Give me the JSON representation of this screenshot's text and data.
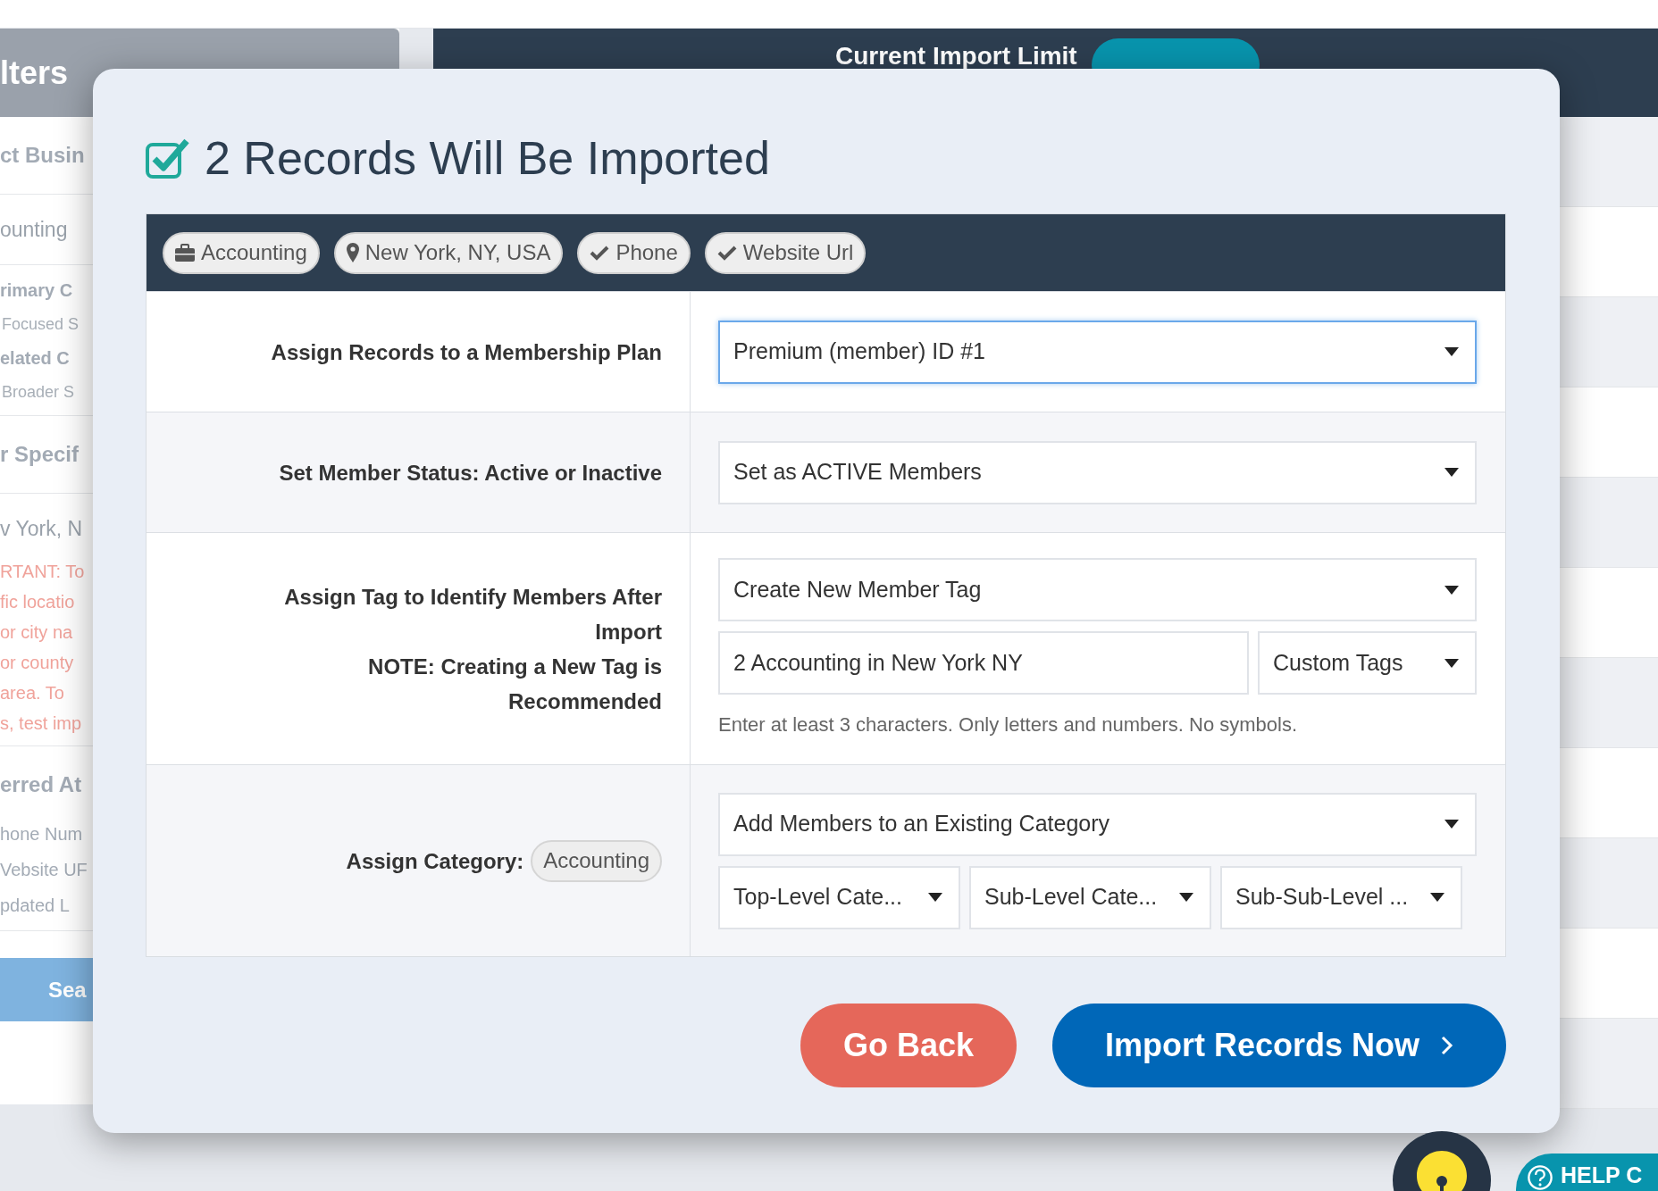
{
  "background": {
    "filters_title": "lters",
    "sections": [
      {
        "items": [
          {
            "kind": "heading",
            "text": "ct Busin"
          }
        ]
      },
      {
        "items": [
          {
            "kind": "value",
            "text": "ounting"
          }
        ]
      },
      {
        "items": [
          {
            "kind": "label",
            "text": "rimary C"
          },
          {
            "kind": "note",
            "text": "Focused S"
          },
          {
            "kind": "label",
            "text": "elated C"
          },
          {
            "kind": "note",
            "text": "Broader S"
          }
        ]
      },
      {
        "items": [
          {
            "kind": "heading",
            "text": "r Specif"
          }
        ]
      },
      {
        "items": [
          {
            "kind": "value",
            "text": "v York, N"
          },
          {
            "kind": "warning",
            "text": "RTANT: To"
          },
          {
            "kind": "warning",
            "text": "fic locatio"
          },
          {
            "kind": "warning",
            "text": "or city na"
          },
          {
            "kind": "warning",
            "text": "or county"
          },
          {
            "kind": "warning",
            "text": "area. To"
          },
          {
            "kind": "warning",
            "text": "s, test imp"
          }
        ]
      },
      {
        "items": [
          {
            "kind": "heading",
            "text": "erred At"
          },
          {
            "kind": "attr",
            "text": "hone Num"
          },
          {
            "kind": "attr",
            "text": "Vebsite UF"
          },
          {
            "kind": "attr",
            "text": "pdated L"
          }
        ]
      }
    ],
    "search_button": "Sea",
    "import_limit": "Current Import Limit"
  },
  "modal": {
    "title": "2 Records Will Be Imported",
    "title_checked": true,
    "chips": [
      {
        "kind": "industry",
        "label": "Accounting"
      },
      {
        "kind": "location",
        "label": "New York, NY, USA"
      },
      {
        "kind": "check",
        "label": "Phone"
      },
      {
        "kind": "check",
        "label": "Website Url"
      }
    ],
    "rows": [
      {
        "labels": [
          "Assign Records to a Membership Plan"
        ],
        "lines": [
          [
            {
              "kind": "select",
              "value": "Premium (member) ID #1",
              "focused": true
            }
          ]
        ]
      },
      {
        "labels": [
          "Set Member Status: Active or Inactive"
        ],
        "lines": [
          [
            {
              "kind": "select",
              "value": "Set as ACTIVE Members",
              "focused": false
            }
          ]
        ]
      },
      {
        "labels": [
          "Assign Tag to Identify Members After Import",
          "NOTE: Creating a New Tag is Recommended"
        ],
        "lines": [
          [
            {
              "kind": "select",
              "value": "Create New Member Tag",
              "focused": false
            }
          ],
          [
            {
              "kind": "input",
              "value": "2 Accounting in New York NY"
            },
            {
              "kind": "select",
              "value": "Custom Tags",
              "focused": false
            }
          ],
          [
            {
              "kind": "hint",
              "text": "Enter at least 3 characters. Only letters and numbers. No symbols."
            }
          ]
        ]
      },
      {
        "labels": [
          "Assign Category:"
        ],
        "badge": "Accounting",
        "lines": [
          [
            {
              "kind": "select",
              "value": "Add Members to an Existing Category",
              "focused": false
            }
          ],
          [
            {
              "kind": "select",
              "value": "Top-Level Cate...",
              "focused": false
            },
            {
              "kind": "select",
              "value": "Sub-Level Cate...",
              "focused": false
            },
            {
              "kind": "select",
              "value": "Sub-Sub-Level ...",
              "focused": false
            }
          ]
        ]
      }
    ],
    "buttons": [
      {
        "kind": "back",
        "label": "Go Back"
      },
      {
        "kind": "primary",
        "label": "Import Records Now"
      }
    ]
  },
  "help": {
    "label": "HELP C"
  }
}
